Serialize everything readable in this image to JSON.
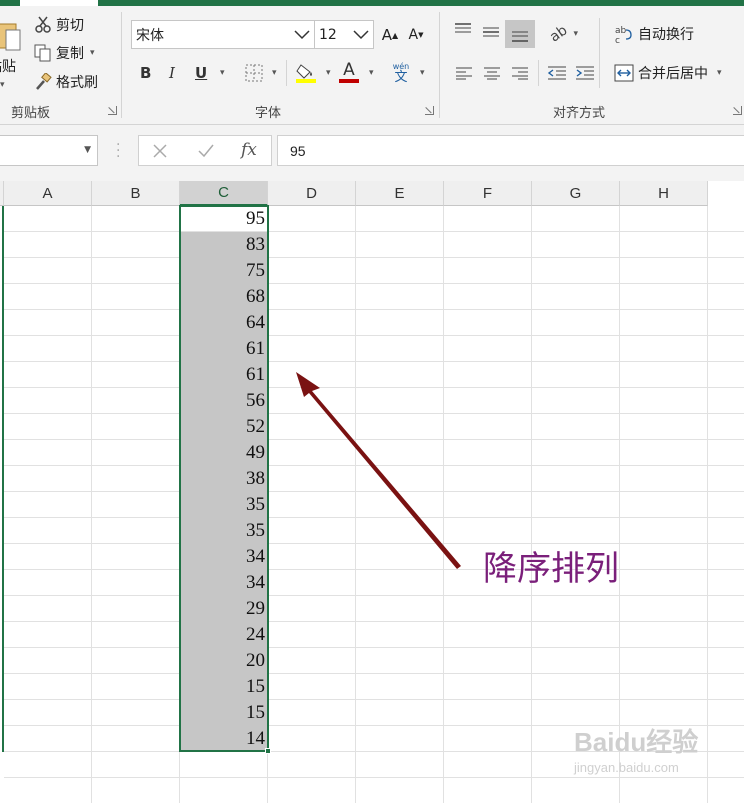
{
  "clipboard": {
    "paste_label": "粘贴",
    "cut_label": "剪切",
    "copy_label": "复制",
    "format_painter_label": "格式刷",
    "group_label": "剪贴板"
  },
  "font": {
    "font_name": "宋体",
    "font_size": "12",
    "bold": "B",
    "italic": "I",
    "underline": "U",
    "pinyin": "wén",
    "group_label": "字体",
    "highlight_color": "#ffff00",
    "font_color": "#c00000"
  },
  "alignment": {
    "wrap_text_label": "自动换行",
    "merge_center_label": "合并后居中",
    "group_label": "对齐方式"
  },
  "formula_bar": {
    "name_box": "",
    "fx": "fx",
    "value": "95"
  },
  "sheet": {
    "columns": [
      "A",
      "B",
      "C",
      "D",
      "E",
      "F",
      "G",
      "H"
    ],
    "selected_column": "C",
    "values": [
      "95",
      "83",
      "75",
      "68",
      "64",
      "61",
      "61",
      "56",
      "52",
      "49",
      "38",
      "35",
      "35",
      "34",
      "34",
      "29",
      "24",
      "20",
      "15",
      "15",
      "14"
    ]
  },
  "annotation": {
    "text": "降序排列",
    "color": "#7a1f7a"
  },
  "watermark": {
    "line1": "Baidu经验",
    "line2": "jingyan.baidu.com"
  }
}
